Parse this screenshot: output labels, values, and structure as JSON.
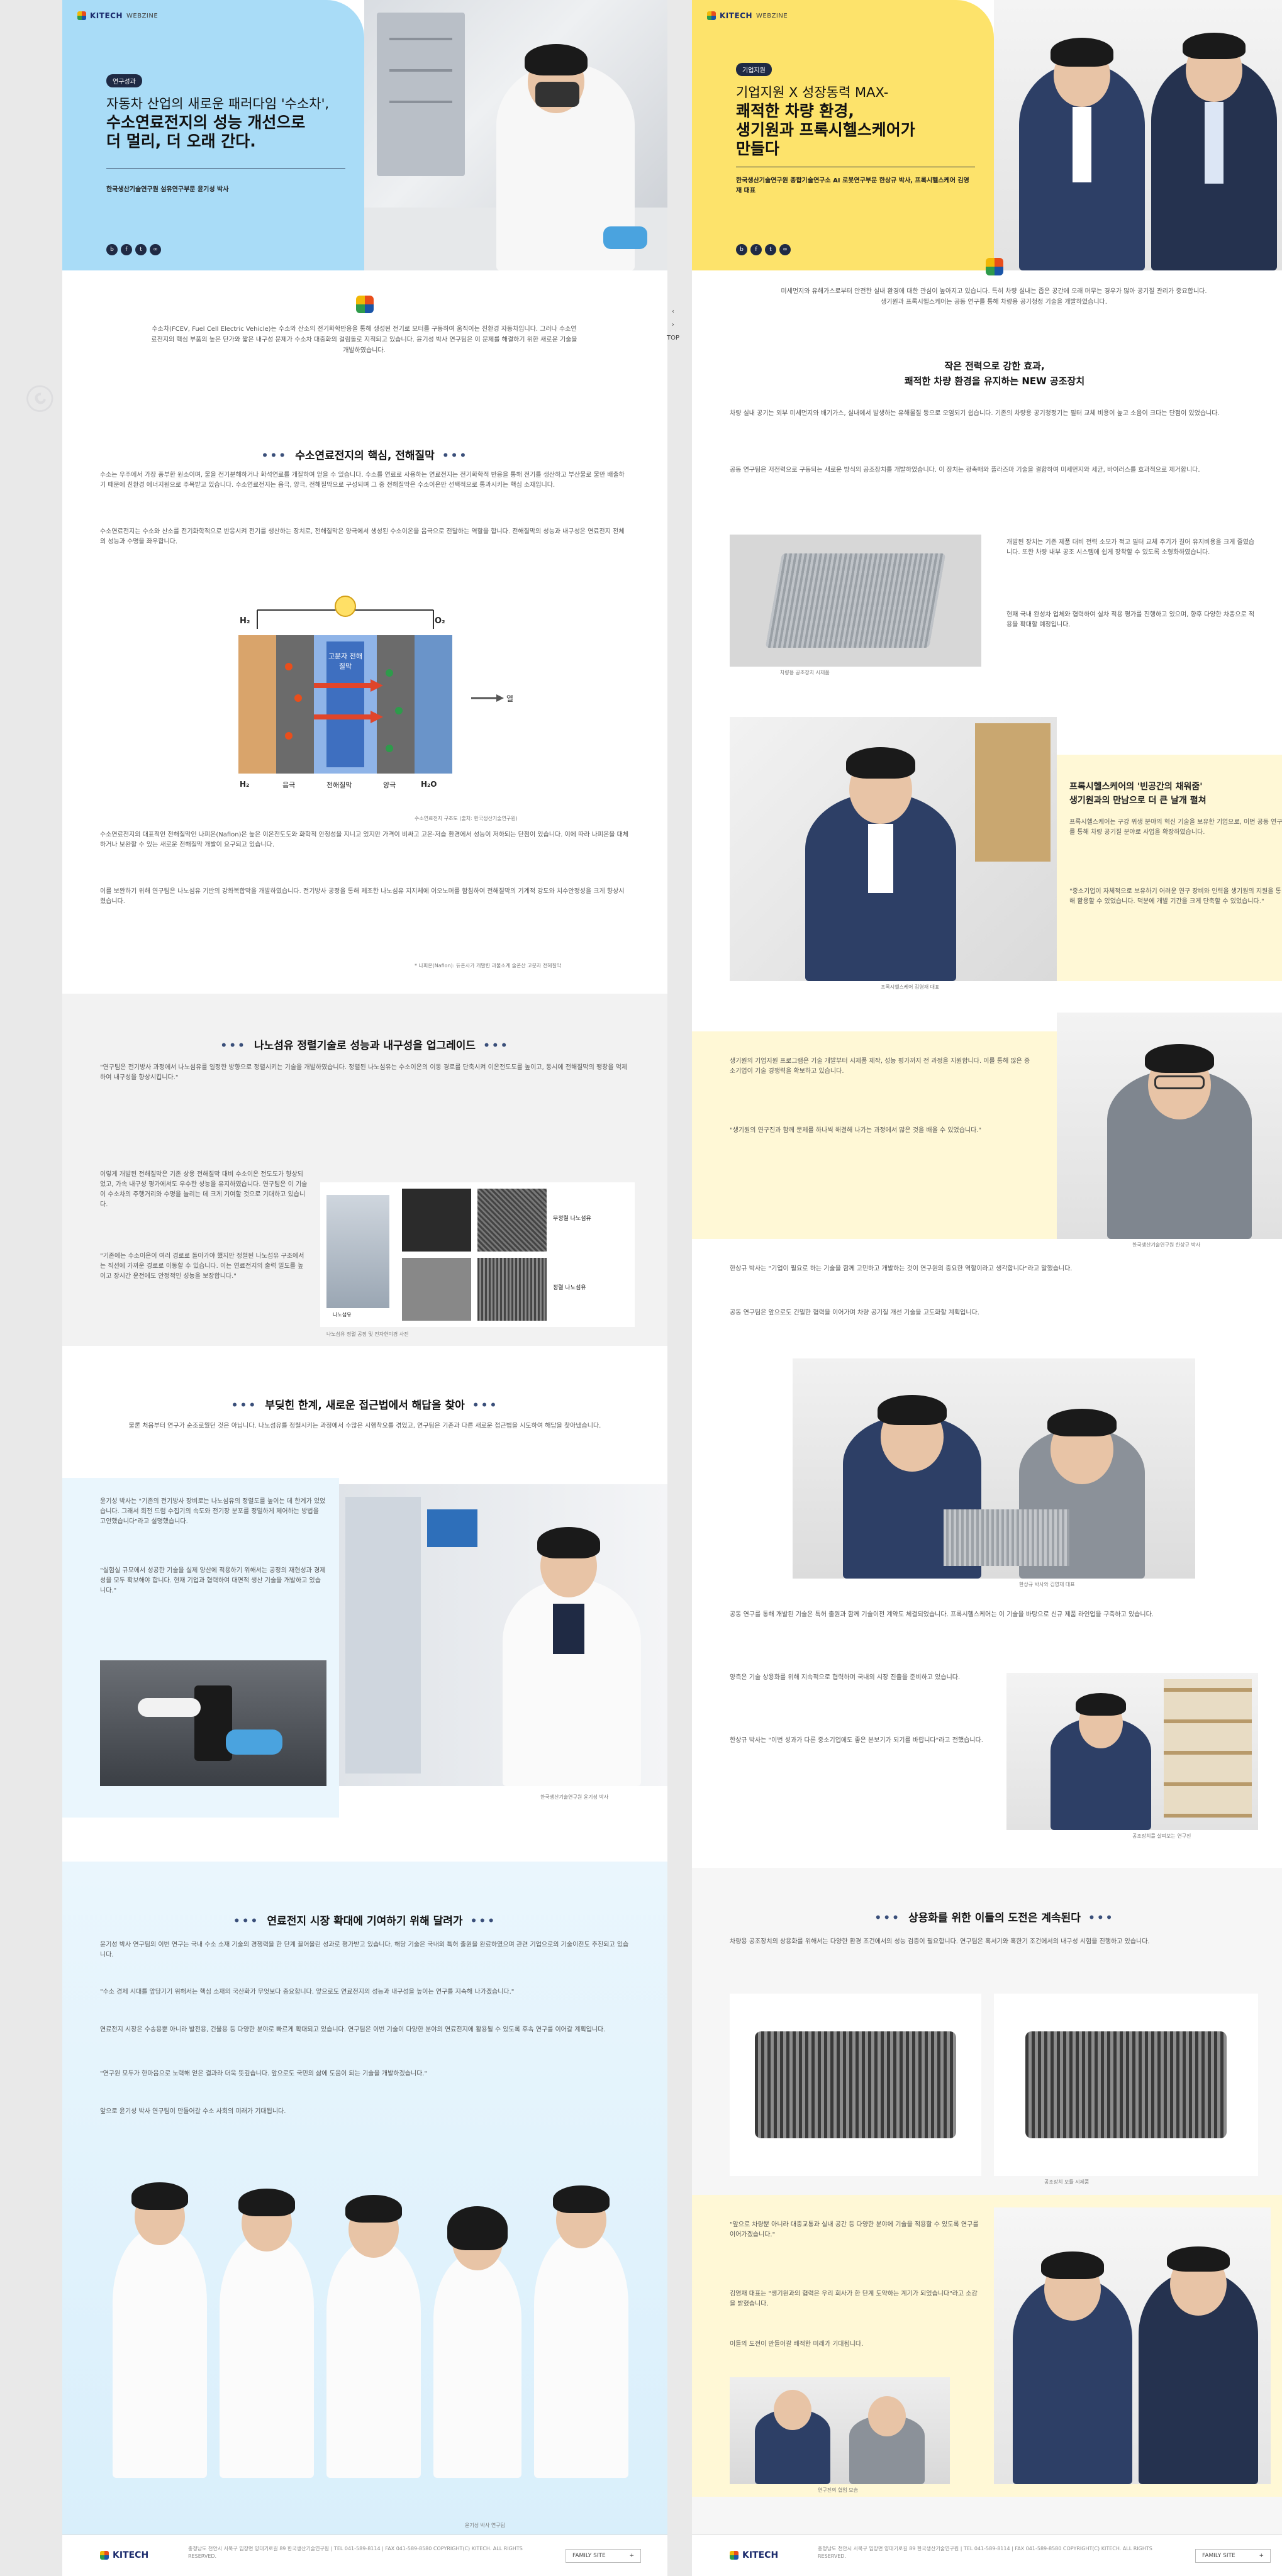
{
  "left": {
    "logo": "KITECH",
    "logo_sub": "WEBZINE",
    "badge": "연구성과",
    "hero_title_line1": "자동차 산업의 새로운 패러다임 '수소차',",
    "hero_title_line2": "수소연료전지의 성능 개선으로",
    "hero_title_line3": "더 멀리, 더 오래 간다.",
    "hero_sub": "한국생산기술연구원 섬유연구부문 윤기성 박사",
    "intro": "수소차(FCEV, Fuel Cell Electric Vehicle)는 수소와 산소의 전기화학반응을 통해 생성된 전기로 모터를 구동하여 움직이는 친환경 자동차입니다. 그러나 수소연료전지의 핵심 부품의 높은 단가와 짧은 내구성 문제가 수소차 대중화의 걸림돌로 지적되고 있습니다. 윤기성 박사 연구팀은 이 문제를 해결하기 위한 새로운 기술을 개발하였습니다.",
    "sec1": "수소연료전지의 핵심, 전해질막",
    "sec1_p1": "수소는 우주에서 가장 풍부한 원소이며, 물을 전기분해하거나 화석연료를 개질하여 얻을 수 있습니다. 수소를 연료로 사용하는 연료전지는 전기화학적 반응을 통해 전기를 생산하고 부산물로 물만 배출하기 때문에 친환경 에너지원으로 주목받고 있습니다. 수소연료전지는 음극, 양극, 전해질막으로 구성되며 그 중 전해질막은 수소이온만 선택적으로 통과시키는 핵심 소재입니다.",
    "sec1_p2": "수소연료전지는 수소와 산소를 전기화학적으로 반응시켜 전기를 생산하는 장치로, 전해질막은 양극에서 생성된 수소이온을 음극으로 전달하는 역할을 합니다. 전해질막의 성능과 내구성은 연료전지 전체의 성능과 수명을 좌우합니다.",
    "diagram": {
      "h2": "H₂",
      "o2": "O₂",
      "membrane": "고분자 전해질막",
      "heat": "열",
      "bottom_h2": "H₂",
      "anode": "음극",
      "electrolyte": "전해질막",
      "cathode": "양극",
      "h2o": "H₂O"
    },
    "fig1_caption": "수소연료전지 구조도 (출처: 한국생산기술연구원)",
    "sec1_p3": "수소연료전지의 대표적인 전해질막인 나피온(Nafion)은 높은 이온전도도와 화학적 안정성을 지니고 있지만 가격이 비싸고 고온·저습 환경에서 성능이 저하되는 단점이 있습니다. 이에 따라 나피온을 대체하거나 보완할 수 있는 새로운 전해질막 개발이 요구되고 있습니다.",
    "sec1_p4": "이를 보완하기 위해 연구팀은 나노섬유 기반의 강화복합막을 개발하였습니다. 전기방사 공정을 통해 제조한 나노섬유 지지체에 이오노머를 함침하여 전해질막의 기계적 강도와 치수안정성을 크게 향상시켰습니다.",
    "sec1_note": "* 나피온(Nafion): 듀폰사가 개발한 과불소계 술폰산 고분자 전해질막",
    "sec2": "나노섬유 정렬기술로 성능과 내구성을 업그레이드",
    "sec2_p1": "\"연구팀은 전기방사 과정에서 나노섬유를 일정한 방향으로 정렬시키는 기술을 개발하였습니다. 정렬된 나노섬유는 수소이온의 이동 경로를 단축시켜 이온전도도를 높이고, 동시에 전해질막의 팽창을 억제하여 내구성을 향상시킵니다.\"",
    "sec2_p2": "이렇게 개발된 전해질막은 기존 상용 전해질막 대비 수소이온 전도도가 향상되었고, 가속 내구성 평가에서도 우수한 성능을 유지하였습니다. 연구팀은 이 기술이 수소차의 주행거리와 수명을 늘리는 데 크게 기여할 것으로 기대하고 있습니다.",
    "sec2_p3": "\"기존에는 수소이온이 여러 경로로 돌아가야 했지만 정렬된 나노섬유 구조에서는 직선에 가까운 경로로 이동할 수 있습니다. 이는 연료전지의 출력 밀도를 높이고 장시간 운전에도 안정적인 성능을 보장합니다.\"",
    "fig2_labels": [
      "나노섬유",
      "무정렬 나노섬유",
      "정렬 나노섬유"
    ],
    "fig2_caption": "나노섬유 정렬 공정 및 전자현미경 사진",
    "sec3": "부딪힌 한계, 새로운 접근법에서 해답을 찾아",
    "sec3_intro": "물론 처음부터 연구가 순조로웠던 것은 아닙니다. 나노섬유를 정렬시키는 과정에서 수많은 시행착오를 겪었고, 연구팀은 기존과 다른 새로운 접근법을 시도하여 해답을 찾아냈습니다.",
    "sec3_p1": "윤기성 박사는 \"기존의 전기방사 장비로는 나노섬유의 정렬도를 높이는 데 한계가 있었습니다. 그래서 회전 드럼 수집기의 속도와 전기장 분포를 정밀하게 제어하는 방법을 고안했습니다\"라고 설명했습니다.",
    "sec3_p2": "\"실험실 규모에서 성공한 기술을 실제 양산에 적용하기 위해서는 공정의 재현성과 경제성을 모두 확보해야 합니다. 현재 기업과 협력하여 대면적 생산 기술을 개발하고 있습니다.\"",
    "sec3_caption": "한국생산기술연구원 윤기성 박사",
    "sec4": "연료전지 시장 확대에 기여하기 위해 달려가",
    "sec4_p1": "윤기성 박사 연구팀의 이번 연구는 국내 수소 소재 기술의 경쟁력을 한 단계 끌어올린 성과로 평가받고 있습니다. 해당 기술은 국내외 특허 출원을 완료하였으며 관련 기업으로의 기술이전도 추진되고 있습니다.",
    "sec4_p2": "\"수소 경제 시대를 앞당기기 위해서는 핵심 소재의 국산화가 무엇보다 중요합니다. 앞으로도 연료전지의 성능과 내구성을 높이는 연구를 지속해 나가겠습니다.\"",
    "sec4_p3": "연료전지 시장은 수송용뿐 아니라 발전용, 건물용 등 다양한 분야로 빠르게 확대되고 있습니다. 연구팀은 이번 기술이 다양한 분야의 연료전지에 활용될 수 있도록 후속 연구를 이어갈 계획입니다.",
    "sec4_p4": "\"연구원 모두가 한마음으로 노력해 얻은 결과라 더욱 뜻깊습니다. 앞으로도 국민의 삶에 도움이 되는 기술을 개발하겠습니다.\"",
    "sec4_p5": "앞으로 윤기성 박사 연구팀이 만들어갈 수소 사회의 미래가 기대됩니다.",
    "team_caption": "윤기성 박사 연구팀",
    "footer_info": "충청남도 천안시 서북구 입장면 양대기로길 89 한국생산기술연구원 | TEL 041-589-8114 | FAX 041-589-8580 COPYRIGHT(C) KITECH. ALL RIGHTS RESERVED.",
    "family_site": "FAMILY SITE"
  },
  "right": {
    "logo": "KITECH",
    "logo_sub": "WEBZINE",
    "badge": "기업지원",
    "hero_title_line1": "기업지원 X 성장동력 MAX-",
    "hero_title_line2": "쾌적한 차량 환경,",
    "hero_title_line3": "생기원과 프록시헬스케어가",
    "hero_title_line4": "만들다",
    "hero_sub": "한국생산기술연구원 종합기술연구소 AI 로봇연구부문 한상규 박사, 프록시헬스케어 김영재 대표",
    "intro": "미세먼지와 유해가스로부터 안전한 실내 환경에 대한 관심이 높아지고 있습니다. 특히 차량 실내는 좁은 공간에 오래 머무는 경우가 많아 공기질 관리가 중요합니다. 생기원과 프록시헬스케어는 공동 연구를 통해 차량용 공기청정 기술을 개발하였습니다.",
    "sec1_title_line1": "작은 전력으로 강한 효과,",
    "sec1_title_line2": "쾌적한 차량 환경을 유지하는 NEW 공조장치",
    "sec1_p1": "차량 실내 공기는 외부 미세먼지와 배기가스, 실내에서 발생하는 유해물질 등으로 오염되기 쉽습니다. 기존의 차량용 공기청정기는 필터 교체 비용이 높고 소음이 크다는 단점이 있었습니다.",
    "sec1_p2": "공동 연구팀은 저전력으로 구동되는 새로운 방식의 공조장치를 개발하였습니다. 이 장치는 광촉매와 플라즈마 기술을 결합하여 미세먼지와 세균, 바이러스를 효과적으로 제거합니다.",
    "sec1_p3": "개발된 장치는 기존 제품 대비 전력 소모가 적고 필터 교체 주기가 길어 유지비용을 크게 줄였습니다. 또한 차량 내부 공조 시스템에 쉽게 장착할 수 있도록 소형화하였습니다.",
    "sec1_p4": "현재 국내 완성차 업체와 협력하여 실차 적용 평가를 진행하고 있으며, 향후 다양한 차종으로 적용을 확대할 예정입니다.",
    "fig1_caption": "차량용 공조장치 시제품",
    "sec2_title_line1": "프록시헬스케어의 '빈공간의 채워줌'",
    "sec2_title_line2": "생기원과의 만남으로 더 큰 날개 펼쳐",
    "sec2_p1": "프록시헬스케어는 구강 위생 분야의 혁신 기술을 보유한 기업으로, 이번 공동 연구를 통해 차량 공기질 분야로 사업을 확장하였습니다.",
    "sec2_p2": "\"중소기업이 자체적으로 보유하기 어려운 연구 장비와 인력을 생기원의 지원을 통해 활용할 수 있었습니다. 덕분에 개발 기간을 크게 단축할 수 있었습니다.\"",
    "sec2_p3": "생기원의 기업지원 프로그램은 기술 개발부터 시제품 제작, 성능 평가까지 전 과정을 지원합니다. 이를 통해 많은 중소기업이 기술 경쟁력을 확보하고 있습니다.",
    "sec2_p4": "\"생기원의 연구진과 함께 문제를 하나씩 해결해 나가는 과정에서 많은 것을 배울 수 있었습니다.\"",
    "sec2_p5": "한상규 박사는 \"기업이 필요로 하는 기술을 함께 고민하고 개발하는 것이 연구원의 중요한 역할이라고 생각합니다\"라고 말했습니다.",
    "sec2_p6": "공동 연구팀은 앞으로도 긴밀한 협력을 이어가며 차량 공기질 개선 기술을 고도화할 계획입니다.",
    "photo_caption1": "프록시헬스케어 김영재 대표",
    "photo_caption2": "한국생산기술연구원 한상규 박사",
    "photo_caption3": "한상규 박사와 김영재 대표",
    "photo_caption4": "공조장치를 살펴보는 연구진",
    "sec3_p1": "공동 연구를 통해 개발된 기술은 특허 출원과 함께 기술이전 계약도 체결되었습니다. 프록시헬스케어는 이 기술을 바탕으로 신규 제품 라인업을 구축하고 있습니다.",
    "sec3_p2": "양측은 기술 상용화를 위해 지속적으로 협력하며 국내외 시장 진출을 준비하고 있습니다.",
    "sec3_p3": "한상규 박사는 \"이번 성과가 다른 중소기업에도 좋은 본보기가 되기를 바랍니다\"라고 전했습니다.",
    "sec4": "상용화를 위한 이들의 도전은 계속된다",
    "sec4_p1": "차량용 공조장치의 상용화를 위해서는 다양한 환경 조건에서의 성능 검증이 필요합니다. 연구팀은 혹서기와 혹한기 조건에서의 내구성 시험을 진행하고 있습니다.",
    "sec4_p2": "\"앞으로 차량뿐 아니라 대중교통과 실내 공간 등 다양한 분야에 기술을 적용할 수 있도록 연구를 이어가겠습니다.\"",
    "sec4_p3": "김영재 대표는 \"생기원과의 협력은 우리 회사가 한 단계 도약하는 계기가 되었습니다\"라고 소감을 밝혔습니다.",
    "sec4_p4": "이들의 도전이 만들어갈 쾌적한 미래가 기대됩니다.",
    "fig2_caption": "공조장치 모듈 시제품",
    "fig3_caption": "연구진의 협업 모습",
    "footer_info": "충청남도 천안시 서북구 입장면 양대기로길 89 한국생산기술연구원 | TEL 041-589-8114 | FAX 041-589-8580 COPYRIGHT(C) KITECH. ALL RIGHTS RESERVED.",
    "family_site": "FAMILY SITE"
  },
  "share_icons": [
    "blog-icon",
    "facebook-icon",
    "twitter-icon",
    "link-icon"
  ],
  "side_nav": {
    "top_label": "TOP"
  },
  "colors": {
    "left_accent": "#a9dcf7",
    "right_accent": "#fde36b",
    "left_band": "#eaf6fd",
    "right_band": "#fff8d6",
    "navy": "#1f2a44"
  }
}
